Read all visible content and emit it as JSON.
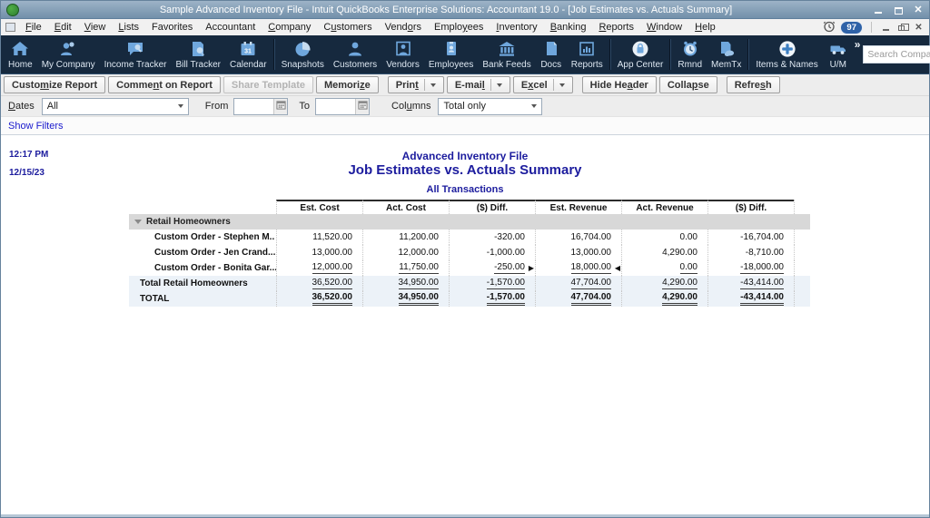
{
  "window": {
    "title": "Sample Advanced Inventory File - Intuit QuickBooks Enterprise Solutions: Accountant 19.0 - [Job Estimates vs. Actuals Summary]"
  },
  "menu": {
    "items": [
      {
        "label": "File",
        "u": 0
      },
      {
        "label": "Edit",
        "u": 0
      },
      {
        "label": "View",
        "u": 0
      },
      {
        "label": "Lists",
        "u": 0
      },
      {
        "label": "Favorites",
        "u": null
      },
      {
        "label": "Accountant",
        "u": null
      },
      {
        "label": "Company",
        "u": 0
      },
      {
        "label": "Customers",
        "u": 1
      },
      {
        "label": "Vendors",
        "u": 4
      },
      {
        "label": "Employees",
        "u": 5
      },
      {
        "label": "Inventory",
        "u": 0
      },
      {
        "label": "Banking",
        "u": 0
      },
      {
        "label": "Reports",
        "u": 0
      },
      {
        "label": "Window",
        "u": 0
      },
      {
        "label": "Help",
        "u": 0
      }
    ],
    "alerts_badge": "97"
  },
  "toolbar": {
    "items": [
      {
        "label": "Home",
        "icon": "home-icon"
      },
      {
        "label": "My Company",
        "icon": "my-company-icon"
      },
      {
        "label": "Income Tracker",
        "icon": "income-tracker-icon"
      },
      {
        "label": "Bill Tracker",
        "icon": "bill-tracker-icon"
      },
      {
        "label": "Calendar",
        "icon": "calendar-icon",
        "sep_after": true
      },
      {
        "label": "Snapshots",
        "icon": "snapshots-icon"
      },
      {
        "label": "Customers",
        "icon": "customers-icon"
      },
      {
        "label": "Vendors",
        "icon": "vendors-icon"
      },
      {
        "label": "Employees",
        "icon": "employees-icon"
      },
      {
        "label": "Bank Feeds",
        "icon": "bank-feeds-icon"
      },
      {
        "label": "Docs",
        "icon": "docs-icon"
      },
      {
        "label": "Reports",
        "icon": "reports-icon",
        "sep_after": true
      },
      {
        "label": "App Center",
        "icon": "app-center-icon",
        "sep_after": true
      },
      {
        "label": "Rmnd",
        "icon": "reminders-icon"
      },
      {
        "label": "MemTx",
        "icon": "memorized-transactions-icon",
        "sep_after": true
      },
      {
        "label": "Items & Names",
        "icon": "items-names-icon"
      },
      {
        "label": "U/M",
        "icon": "unit-of-measure-icon"
      }
    ],
    "more_glyph": "»"
  },
  "search": {
    "placeholder": "Search Company or Help"
  },
  "report_toolbar": {
    "buttons": [
      {
        "label": "Customize Report",
        "u": 5
      },
      {
        "label": "Comment on Report",
        "u": 5
      },
      {
        "label": "Share Template",
        "u": null,
        "disabled": true
      },
      {
        "label": "Memorize",
        "u": 6
      },
      {
        "label": "Print",
        "u": 4,
        "split": true,
        "gap_before": true
      },
      {
        "label": "E-mail",
        "u": 5,
        "split": true
      },
      {
        "label": "Excel",
        "u": 1,
        "split": true
      },
      {
        "label": "Hide Header",
        "u": 7,
        "gap_before": true
      },
      {
        "label": "Collapse",
        "u": 5
      },
      {
        "label": "Refresh",
        "u": 5,
        "gap_before": true
      }
    ]
  },
  "filterbar": {
    "dates_label": "Dates",
    "dates_label_u": 0,
    "dates_value": "All",
    "from_label": "From",
    "from_value": "",
    "to_label": "To",
    "to_value": "",
    "columns_label": "Columns",
    "columns_label_u": 3,
    "columns_value": "Total only"
  },
  "show_filters_label": "Show Filters",
  "report": {
    "time": "12:17 PM",
    "date": "12/15/23",
    "company": "Advanced Inventory File",
    "title": "Job Estimates vs. Actuals Summary",
    "subtitle": "All Transactions"
  },
  "table": {
    "columns": [
      "Est. Cost",
      "Act. Cost",
      "($) Diff.",
      "Est. Revenue",
      "Act. Revenue",
      "($) Diff."
    ],
    "group_label": "Retail Homeowners",
    "rows": [
      {
        "label": "Custom Order - Stephen M..",
        "values": [
          "11,520.00",
          "11,200.00",
          "-320.00",
          "16,704.00",
          "0.00",
          "-16,704.00"
        ]
      },
      {
        "label": "Custom Order - Jen Crand...",
        "values": [
          "13,000.00",
          "12,000.00",
          "-1,000.00",
          "13,000.00",
          "4,290.00",
          "-8,710.00"
        ]
      },
      {
        "label": "Custom Order - Bonita Gar...",
        "values": [
          "12,000.00",
          "11,750.00",
          "-250.00",
          "18,000.00",
          "0.00",
          "-18,000.00"
        ],
        "underline": "single",
        "markers": {
          "2": "▶",
          "3": "◀"
        }
      }
    ],
    "totals": [
      {
        "label": "Total Retail Homeowners",
        "values": [
          "36,520.00",
          "34,950.00",
          "-1,570.00",
          "47,704.00",
          "4,290.00",
          "-43,414.00"
        ],
        "underline": "single",
        "style": "subtotal"
      },
      {
        "label": "TOTAL",
        "values": [
          "36,520.00",
          "34,950.00",
          "-1,570.00",
          "47,704.00",
          "4,290.00",
          "-43,414.00"
        ],
        "underline": "double",
        "style": "grandtotal"
      }
    ]
  },
  "icons": {
    "collapse-triangle": "▼",
    "row-marker-right": "▶",
    "row-marker-left": "◀",
    "chevron-more": "»"
  }
}
